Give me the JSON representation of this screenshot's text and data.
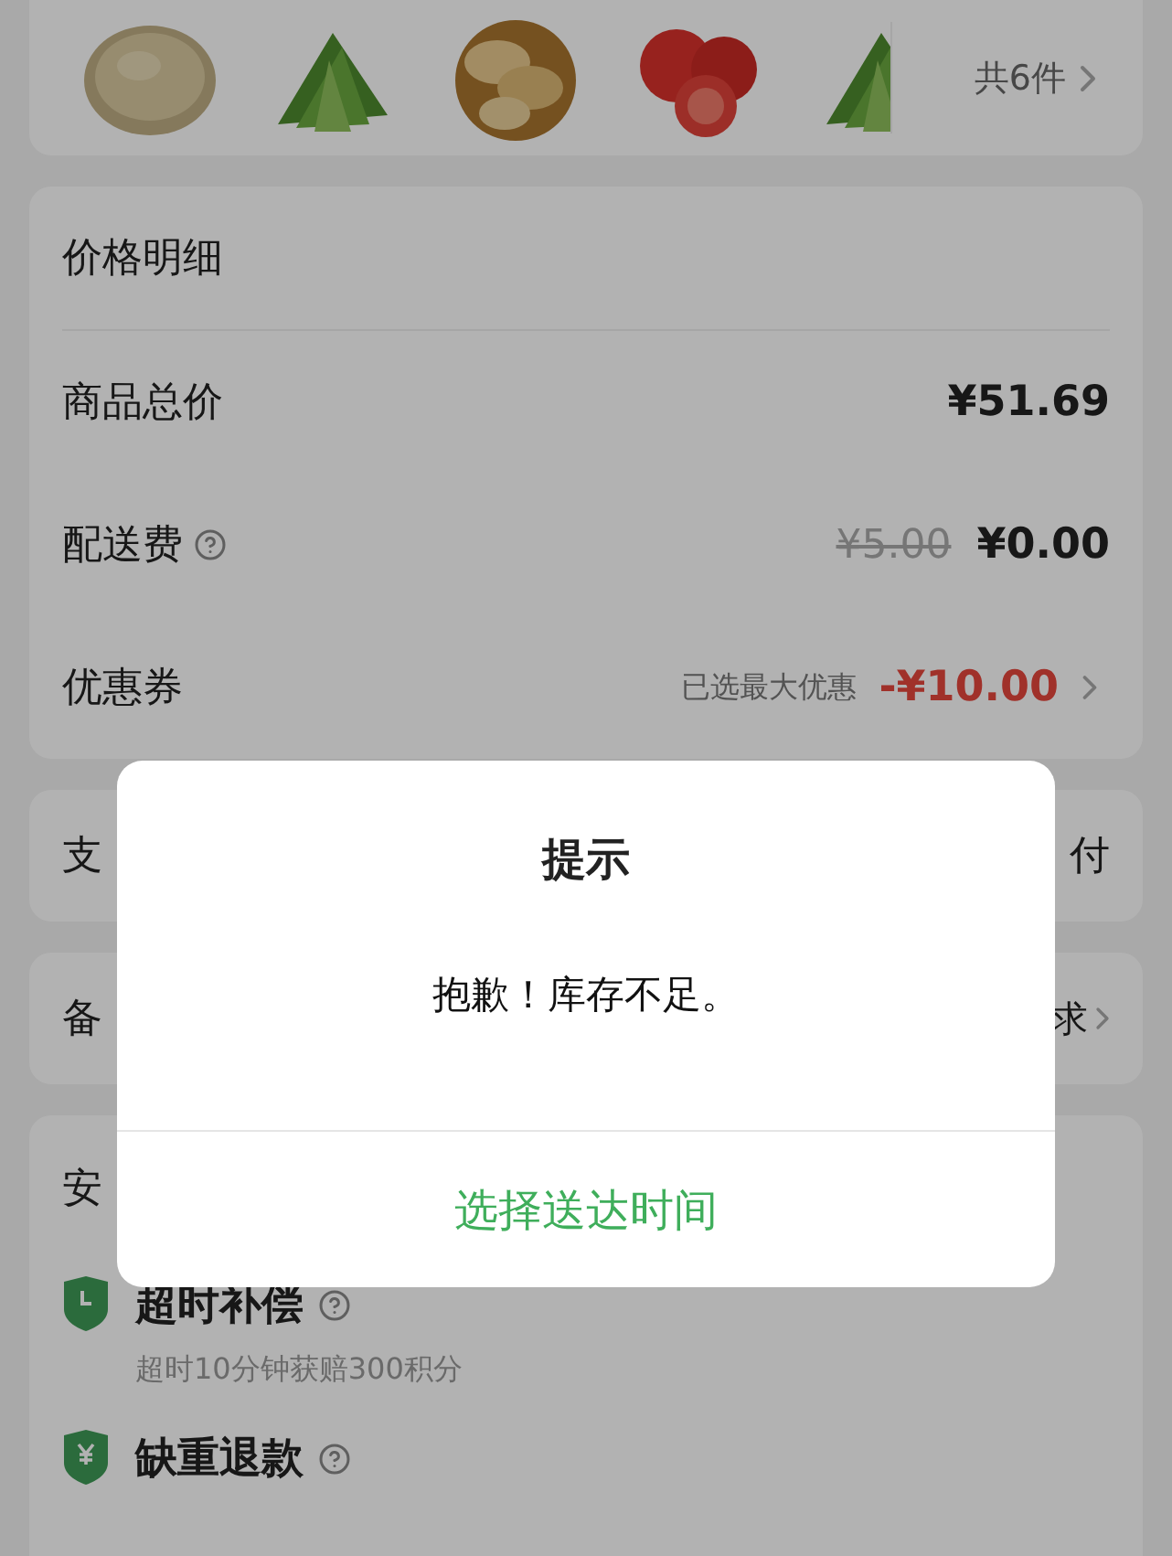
{
  "order_items": {
    "count": "共6件"
  },
  "price_detail": {
    "title": "价格明细",
    "rows": [
      {
        "kind": "plain",
        "label": "商品总价",
        "value": "¥51.69"
      },
      {
        "kind": "delivery",
        "label": "配送费",
        "original": "¥5.00",
        "value": "¥0.00"
      },
      {
        "kind": "coupon",
        "label": "优惠券",
        "note": "已选最大优惠",
        "value": "-¥10.00"
      }
    ]
  },
  "payment": {
    "label": "支",
    "value": "付"
  },
  "remarks": {
    "label": "备",
    "value": "求"
  },
  "assurance": {
    "title": "安",
    "items": [
      {
        "title": "超时补偿",
        "desc": "超时10分钟获赔300积分"
      },
      {
        "title": "缺重退款"
      }
    ]
  },
  "dialog": {
    "title": "提示",
    "message": "抱歉！库存不足。",
    "action": "选择送达时间"
  }
}
